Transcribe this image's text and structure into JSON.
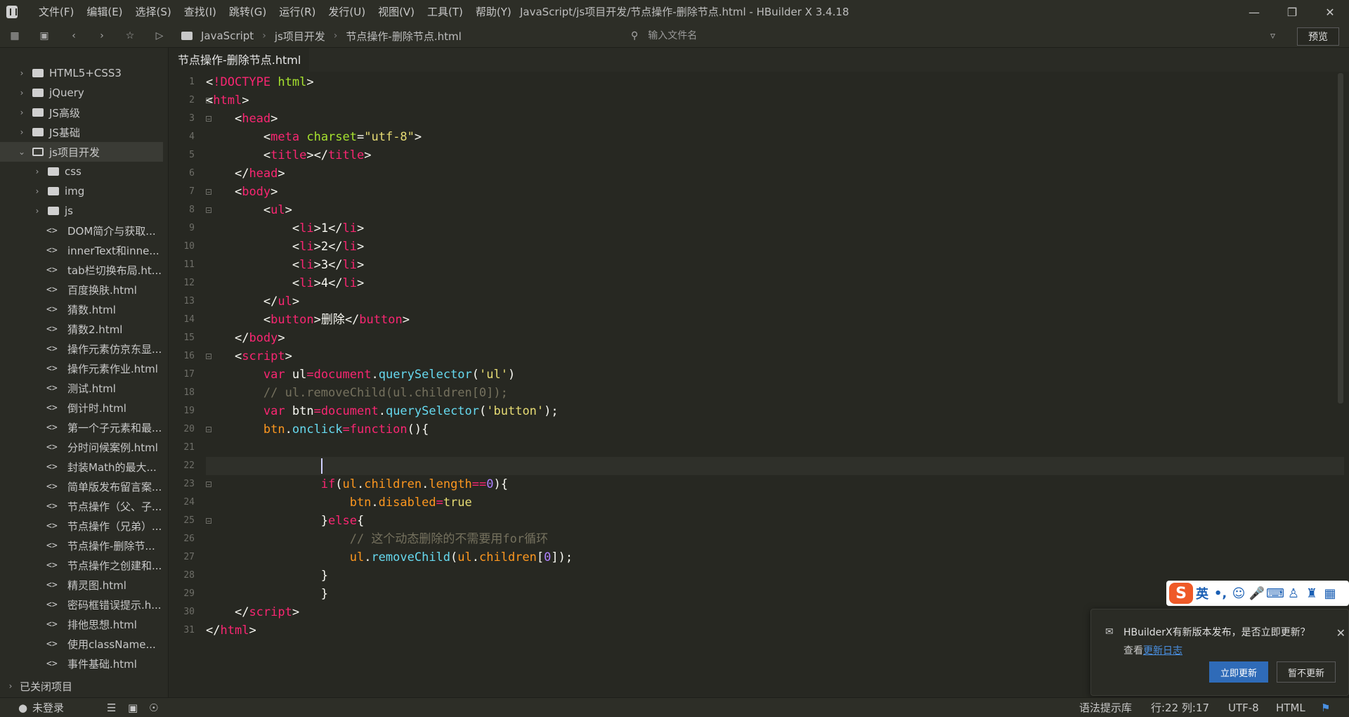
{
  "app": {
    "window_title": "JavaScript/js项目开发/节点操作-删除节点.html - HBuilder X 3.4.18",
    "menu": [
      "文件(F)",
      "编辑(E)",
      "选择(S)",
      "查找(I)",
      "跳转(G)",
      "运行(R)",
      "发行(U)",
      "视图(V)",
      "工具(T)",
      "帮助(Y)"
    ]
  },
  "toolbar": {
    "breadcrumb": [
      "JavaScript",
      "js项目开发",
      "节点操作-删除节点.html"
    ],
    "file_search_placeholder": "输入文件名",
    "preview_label": "预览"
  },
  "sidebar": {
    "projects": [
      "HTML5+CSS3",
      "jQuery",
      "JS高级",
      "JS基础"
    ],
    "open_project": "js项目开发",
    "subfolders": [
      "css",
      "img",
      "js"
    ],
    "files": [
      "DOM简介与获取...",
      "innerText和inne...",
      "tab栏切换布局.ht...",
      "百度换肤.html",
      "猜数.html",
      "猜数2.html",
      "操作元素仿京东显...",
      "操作元素作业.html",
      "测试.html",
      "倒计时.html",
      "第一个子元素和最...",
      "分时问候案例.html",
      "封装Math的最大...",
      "简单版发布留言案...",
      "节点操作（父、子...",
      "节点操作（兄弟）...",
      "节点操作-删除节...",
      "节点操作之创建和...",
      "精灵图.html",
      "密码框错误提示.h...",
      "排他思想.html",
      "使用className...",
      "事件基础.html"
    ],
    "closed_projects_label": "已关闭项目"
  },
  "editor": {
    "tab_label": "节点操作-删除节点.html",
    "line_numbers": [
      "1",
      "2",
      "3",
      "4",
      "5",
      "6",
      "7",
      "8",
      "9",
      "10",
      "11",
      "12",
      "13",
      "14",
      "15",
      "16",
      "17",
      "18",
      "19",
      "20",
      "21",
      "22",
      "23",
      "24",
      "25",
      "26",
      "27",
      "28",
      "29",
      "30",
      "31"
    ]
  },
  "ime": {
    "logo": "S",
    "mode": "英"
  },
  "notification": {
    "message": "HBuilderX有新版本发布，是否立即更新？",
    "sub_prefix": "查看",
    "link_text": "更新日志",
    "update_label": "立即更新",
    "later_label": "暂不更新"
  },
  "statusbar": {
    "login": "未登录",
    "syntax_lib": "语法提示库",
    "position": "行:22  列:17",
    "encoding": "UTF-8",
    "language": "HTML"
  },
  "colors": {
    "background": "#272822",
    "tag": "#f92672",
    "attribute": "#a6e22e",
    "string": "#e6db74",
    "keyword": "#66d9ef",
    "number": "#ae81ff",
    "comment": "#75715e",
    "accent_button": "#2f6bb8"
  }
}
